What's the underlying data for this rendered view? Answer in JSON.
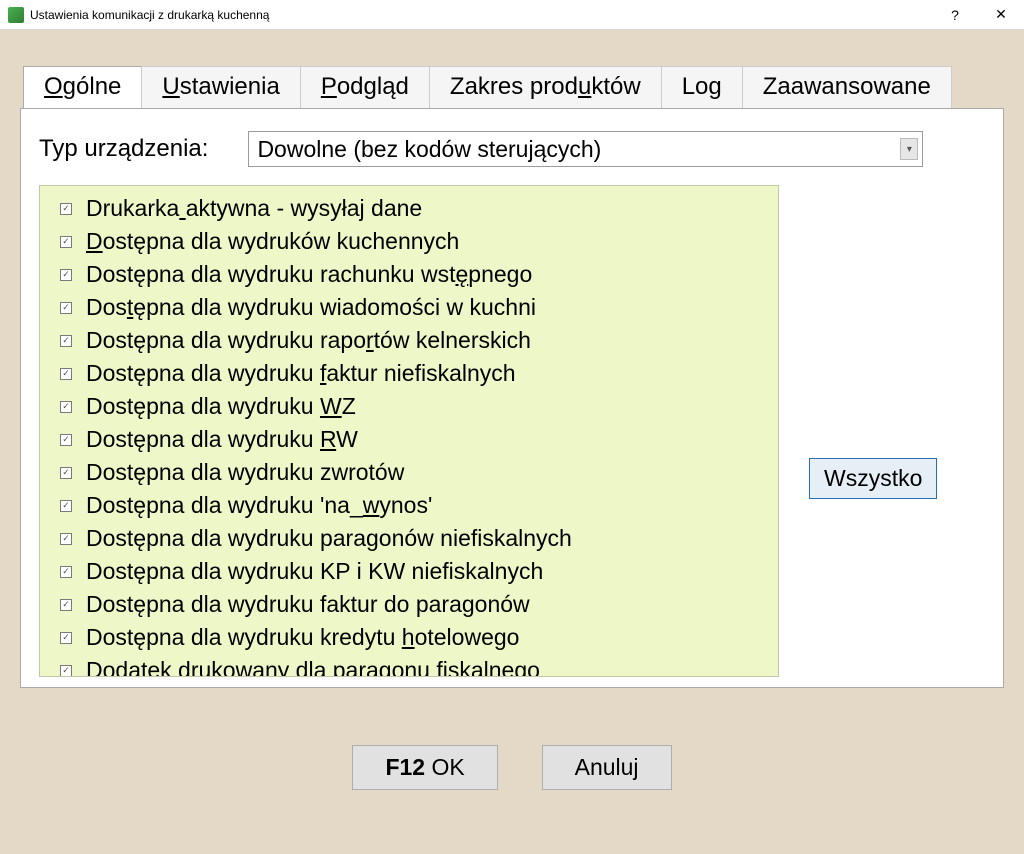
{
  "window": {
    "title": "Ustawienia komunikacji z drukarką kuchenną",
    "help": "?",
    "close": "✕"
  },
  "tabs": [
    {
      "label": "Ogólne",
      "accel": "O",
      "active": true
    },
    {
      "label": "Ustawienia",
      "accel": "U"
    },
    {
      "label": "Podgląd",
      "accel": "P"
    },
    {
      "label": "Zakres produktów",
      "accel": "u"
    },
    {
      "label": "Log"
    },
    {
      "label": "Zaawansowane"
    }
  ],
  "deviceType": {
    "label": "Typ urządzenia:",
    "value": "Dowolne (bez kodów sterujących)"
  },
  "checklist": [
    {
      "text": "Drukarka aktywna - wysyłaj dane",
      "u": 8
    },
    {
      "text": "Dostępna dla wydruków kuchennych",
      "u": 0
    },
    {
      "text": "Dostępna dla wydruku rachunku wstępnego",
      "u": 33
    },
    {
      "text": "Dostępna dla wydruku wiadomości w kuchni",
      "u": 3
    },
    {
      "text": "Dostępna dla wydruku raportów kelnerskich",
      "u": 25
    },
    {
      "text": "Dostępna dla wydruku faktur niefiskalnych",
      "u": 21
    },
    {
      "text": "Dostępna dla wydruku WZ",
      "u": 21
    },
    {
      "text": "Dostępna dla wydruku RW",
      "u": 21
    },
    {
      "text": "Dostępna dla wydruku zwrotów",
      "u": -1
    },
    {
      "text": "Dostępna dla wydruku 'na_wynos'",
      "u": 25
    },
    {
      "text": "Dostępna dla wydruku paragonów niefiskalnych",
      "u": -1
    },
    {
      "text": "Dostępna dla wydruku KP i KW niefiskalnych",
      "u": -1
    },
    {
      "text": "Dostępna dla wydruku faktur do paragonów",
      "u": -1
    },
    {
      "text": "Dostępna dla wydruku kredytu hotelowego",
      "u": 29
    },
    {
      "text": "Dodatek drukowany dla paragonu fiskalnego",
      "u": 31
    }
  ],
  "buttons": {
    "all": "Wszystko",
    "ok_key": "F12",
    "ok_rest": " OK",
    "cancel": "Anuluj"
  }
}
